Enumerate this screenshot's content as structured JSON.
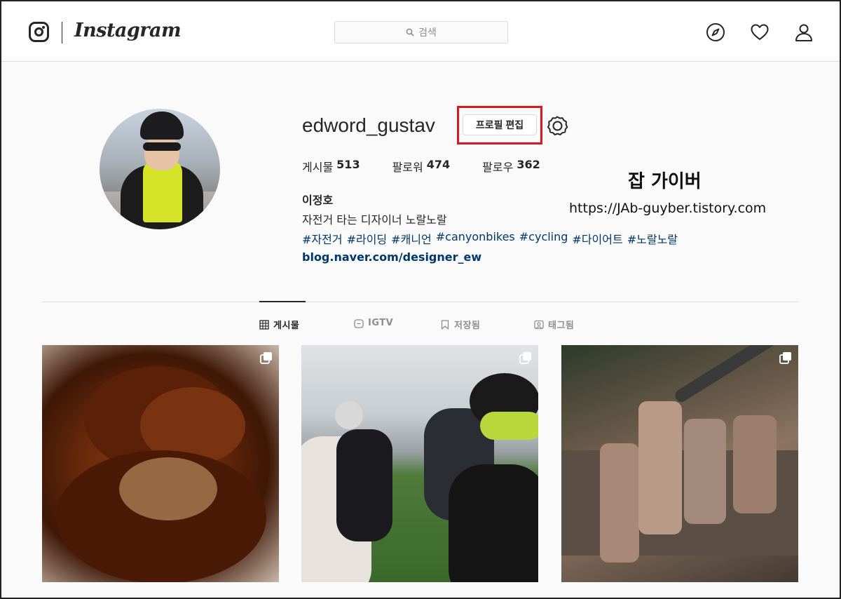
{
  "header": {
    "brand": "Instagram",
    "search_placeholder": "검색"
  },
  "icons": {
    "logo": "instagram-glyph-icon",
    "explore": "compass-icon",
    "activity": "heart-icon",
    "profile": "person-icon",
    "settings": "gear-icon",
    "multi_post": "carousel-icon"
  },
  "profile": {
    "username": "edword_gustav",
    "edit_button": "프로필 편집",
    "stats": [
      {
        "label": "게시물",
        "value": "513"
      },
      {
        "label": "팔로워",
        "value": "474"
      },
      {
        "label": "팔로우",
        "value": "362"
      }
    ],
    "full_name": "이정호",
    "bio": "자전거 타는 디자이너 노랄노랄",
    "hashtags": [
      "#자전거",
      "#라이딩",
      "#캐니언",
      "#canyonbikes",
      "#cycling",
      "#다이어트",
      "#노랄노랄"
    ],
    "link": "blog.naver.com/designer_ew"
  },
  "watermark": {
    "title": "잡 가이버",
    "url": "https://JAb-guyber.tistory.com"
  },
  "tabs": [
    {
      "label": "게시물",
      "icon": "grid-icon",
      "active": true
    },
    {
      "label": "IGTV",
      "icon": "igtv-icon",
      "active": false
    },
    {
      "label": "저장됨",
      "icon": "bookmark-icon",
      "active": false
    },
    {
      "label": "태그됨",
      "icon": "tag-person-icon",
      "active": false
    }
  ],
  "colors": {
    "highlight_box": "#d9181f",
    "link": "#00376b",
    "border": "#dbdbdb"
  }
}
